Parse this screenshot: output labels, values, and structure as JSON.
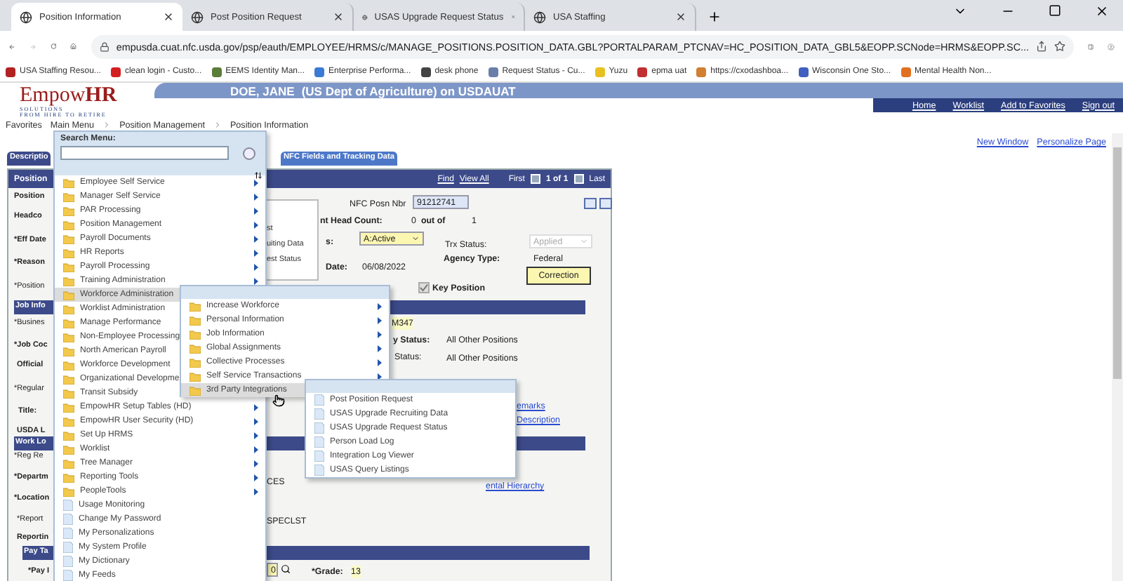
{
  "browser": {
    "tabs": [
      {
        "title": "Position Information",
        "selected": true
      },
      {
        "title": "Post Position Request",
        "selected": false
      },
      {
        "title": "USAS Upgrade Request Status",
        "selected": false
      },
      {
        "title": "USA Staffing",
        "selected": false
      }
    ],
    "url": "empusda.cuat.nfc.usda.gov/psp/eauth/EMPLOYEE/HRMS/c/MANAGE_POSITIONS.POSITION_DATA.GBL?PORTALPARAM_PTCNAV=HC_POSITION_DATA_GBL5&EOPP.SCNode=HRMS&EOPP.SC...",
    "bookmarks": [
      {
        "label": "USA Staffing Resou...",
        "color": "#b22222"
      },
      {
        "label": "clean login - Custo...",
        "color": "#d42020"
      },
      {
        "label": "EEMS Identity Man...",
        "color": "#5a7d3a"
      },
      {
        "label": "Enterprise Performa...",
        "color": "#3a7bd5"
      },
      {
        "label": "desk phone",
        "color": "#444444"
      },
      {
        "label": "Request Status - Cu...",
        "color": "#6a7fa8"
      },
      {
        "label": "Yuzu",
        "color": "#e8c020"
      },
      {
        "label": "epma uat",
        "color": "#c03030"
      },
      {
        "label": "https://cxodashboa...",
        "color": "#d08030"
      },
      {
        "label": "Wisconsin One Sto...",
        "color": "#4060c0"
      },
      {
        "label": "Mental Health Non...",
        "color": "#e07020"
      }
    ]
  },
  "logo": {
    "word": "Empow",
    "accent": "HR",
    "sub": "SOLUTIONS",
    "tagline": "FROM HIRE TO RETIRE"
  },
  "header": {
    "user": "DOE, JANE",
    "org": "(US Dept of Agriculture) on USDAUAT",
    "links": [
      "Home",
      "Worklist",
      "Add to Favorites",
      "Sign out"
    ]
  },
  "breadcrumb": [
    "Favorites",
    "Main Menu",
    "Position Management",
    "Position Information"
  ],
  "page_links": [
    "New Window",
    "Personalize Page"
  ],
  "page_tabs": [
    {
      "label": "Descriptio",
      "selected": true
    },
    {
      "label": "NFC Fields and Tracking Data",
      "selected": false
    }
  ],
  "form": {
    "title": "Position",
    "find": "Find",
    "view_all": "View All",
    "first": "First",
    "count": "1 of 1",
    "last": "Last",
    "fragments": [
      {
        "kind": "bold",
        "text": "Position"
      },
      {
        "kind": "bold",
        "text": "Headco"
      },
      {
        "kind": "bold",
        "text": "*Eff Date"
      },
      {
        "kind": "bold",
        "text": "*Reason"
      },
      {
        "kind": "label",
        "text": "*Position"
      },
      {
        "kind": "section",
        "text": "Job Info"
      },
      {
        "kind": "label",
        "text": "*Busines"
      },
      {
        "kind": "bold",
        "text": "*Job Coc"
      },
      {
        "kind": "bold",
        "text": "Official"
      },
      {
        "kind": "label",
        "text": "*Regular"
      },
      {
        "kind": "bold",
        "text": "Title:"
      },
      {
        "kind": "bold",
        "text": "USDA L"
      },
      {
        "kind": "section",
        "text": "Work Lo"
      },
      {
        "kind": "label",
        "text": "*Reg Re"
      },
      {
        "kind": "bold",
        "text": "*Departm"
      },
      {
        "kind": "bold",
        "text": "*Location"
      },
      {
        "kind": "label",
        "text": "*Report"
      },
      {
        "kind": "bold",
        "text": "Reportin"
      },
      {
        "kind": "section",
        "text": "Pay Ta"
      },
      {
        "kind": "bold",
        "text": "*Pay I"
      },
      {
        "kind": "label",
        "text": "NFC Posn Nbr"
      },
      {
        "kind": "input",
        "text": "91212741"
      },
      {
        "kind": "bold",
        "text": "nt Head Count:"
      },
      {
        "kind": "value",
        "text": "0"
      },
      {
        "kind": "bold",
        "text": "out of"
      },
      {
        "kind": "value",
        "text": "1"
      },
      {
        "kind": "bold",
        "text": "s:"
      },
      {
        "kind": "select",
        "text": "A:Active"
      },
      {
        "kind": "label",
        "text": "Trx Status:"
      },
      {
        "kind": "disabled",
        "text": "Applied"
      },
      {
        "kind": "bold",
        "text": "Agency Type:"
      },
      {
        "kind": "value",
        "text": "Federal"
      },
      {
        "kind": "bold",
        "text": "Date:"
      },
      {
        "kind": "value",
        "text": "06/08/2022"
      },
      {
        "kind": "button",
        "text": "Correction"
      },
      {
        "kind": "checkbox",
        "text": "Key Position",
        "checked": true
      },
      {
        "kind": "highlight",
        "text": "M347"
      },
      {
        "kind": "bold",
        "text": "y Status:"
      },
      {
        "kind": "value",
        "text": "All Other Positions"
      },
      {
        "kind": "label",
        "text": "Status:"
      },
      {
        "kind": "value",
        "text": "All Other Positions"
      },
      {
        "kind": "link",
        "text": "emarks"
      },
      {
        "kind": "link",
        "text": "Description"
      },
      {
        "kind": "value",
        "text": "CES"
      },
      {
        "kind": "link",
        "text": "ental Hierarchy"
      },
      {
        "kind": "value",
        "text": "SPECLST"
      },
      {
        "kind": "lookup",
        "text": "0"
      },
      {
        "kind": "bold",
        "text": "*Grade:"
      },
      {
        "kind": "highlight",
        "text": "13"
      }
    ]
  },
  "stale_menu": [
    "st",
    "uiting Data",
    "est Status"
  ],
  "main_menu": {
    "search_label": "Search Menu:",
    "items": [
      {
        "label": "Employee Self Service",
        "kind": "folder",
        "arrow": true,
        "selected": false
      },
      {
        "label": "Manager Self Service",
        "kind": "folder",
        "arrow": true,
        "selected": false
      },
      {
        "label": "PAR Processing",
        "kind": "folder",
        "arrow": true,
        "selected": false
      },
      {
        "label": "Position Management",
        "kind": "folder",
        "arrow": true,
        "selected": false
      },
      {
        "label": "Payroll Documents",
        "kind": "folder",
        "arrow": true,
        "selected": false
      },
      {
        "label": "HR Reports",
        "kind": "folder",
        "arrow": true,
        "selected": false
      },
      {
        "label": "Payroll Processing",
        "kind": "folder",
        "arrow": true,
        "selected": false
      },
      {
        "label": "Training Administration",
        "kind": "folder",
        "arrow": true,
        "selected": false
      },
      {
        "label": "Workforce Administration",
        "kind": "folder",
        "arrow": false,
        "selected": true
      },
      {
        "label": "Worklist Administration",
        "kind": "folder",
        "arrow": false,
        "selected": false
      },
      {
        "label": "Manage Performance",
        "kind": "folder",
        "arrow": false,
        "selected": false
      },
      {
        "label": "Non-Employee Processing",
        "kind": "folder",
        "arrow": false,
        "selected": false
      },
      {
        "label": "North American Payroll",
        "kind": "folder",
        "arrow": false,
        "selected": false
      },
      {
        "label": "Workforce Development",
        "kind": "folder",
        "arrow": false,
        "selected": false
      },
      {
        "label": "Organizational Developme",
        "kind": "folder",
        "arrow": false,
        "selected": false
      },
      {
        "label": "Transit Subsidy",
        "kind": "folder",
        "arrow": false,
        "selected": false
      },
      {
        "label": "EmpowHR Setup Tables (HD)",
        "kind": "folder",
        "arrow": true,
        "selected": false
      },
      {
        "label": "EmpowHR User Security (HD)",
        "kind": "folder",
        "arrow": true,
        "selected": false
      },
      {
        "label": "Set Up HRMS",
        "kind": "folder",
        "arrow": true,
        "selected": false
      },
      {
        "label": "Worklist",
        "kind": "folder",
        "arrow": true,
        "selected": false
      },
      {
        "label": "Tree Manager",
        "kind": "folder",
        "arrow": true,
        "selected": false
      },
      {
        "label": "Reporting Tools",
        "kind": "folder",
        "arrow": true,
        "selected": false
      },
      {
        "label": "PeopleTools",
        "kind": "folder",
        "arrow": true,
        "selected": false
      },
      {
        "label": "Usage Monitoring",
        "kind": "page",
        "arrow": false,
        "selected": false
      },
      {
        "label": "Change My Password",
        "kind": "page",
        "arrow": false,
        "selected": false
      },
      {
        "label": "My Personalizations",
        "kind": "page",
        "arrow": false,
        "selected": false
      },
      {
        "label": "My System Profile",
        "kind": "page",
        "arrow": false,
        "selected": false
      },
      {
        "label": "My Dictionary",
        "kind": "page",
        "arrow": false,
        "selected": false
      },
      {
        "label": "My Feeds",
        "kind": "page",
        "arrow": false,
        "selected": false
      }
    ]
  },
  "submenu": {
    "items": [
      {
        "label": "Increase Workforce",
        "kind": "folder",
        "arrow": true,
        "selected": false
      },
      {
        "label": "Personal Information",
        "kind": "folder",
        "arrow": true,
        "selected": false
      },
      {
        "label": "Job Information",
        "kind": "folder",
        "arrow": true,
        "selected": false
      },
      {
        "label": "Global Assignments",
        "kind": "folder",
        "arrow": true,
        "selected": false
      },
      {
        "label": "Collective Processes",
        "kind": "folder",
        "arrow": true,
        "selected": false
      },
      {
        "label": "Self Service Transactions",
        "kind": "folder",
        "arrow": true,
        "selected": false
      },
      {
        "label": "3rd Party Integrations",
        "kind": "folder",
        "arrow": false,
        "selected": true
      }
    ]
  },
  "submenu_2": {
    "items": [
      {
        "label": "Post Position Request",
        "kind": "page",
        "arrow": false,
        "selected": false
      },
      {
        "label": "USAS Upgrade Recruiting Data",
        "kind": "page",
        "arrow": false,
        "selected": false
      },
      {
        "label": "USAS Upgrade Request Status",
        "kind": "page",
        "arrow": false,
        "selected": false
      },
      {
        "label": "Person Load Log",
        "kind": "page",
        "arrow": false,
        "selected": false
      },
      {
        "label": "Integration Log Viewer",
        "kind": "page",
        "arrow": false,
        "selected": false
      },
      {
        "label": "USAS Query Listings",
        "kind": "page",
        "arrow": false,
        "selected": false
      }
    ]
  }
}
